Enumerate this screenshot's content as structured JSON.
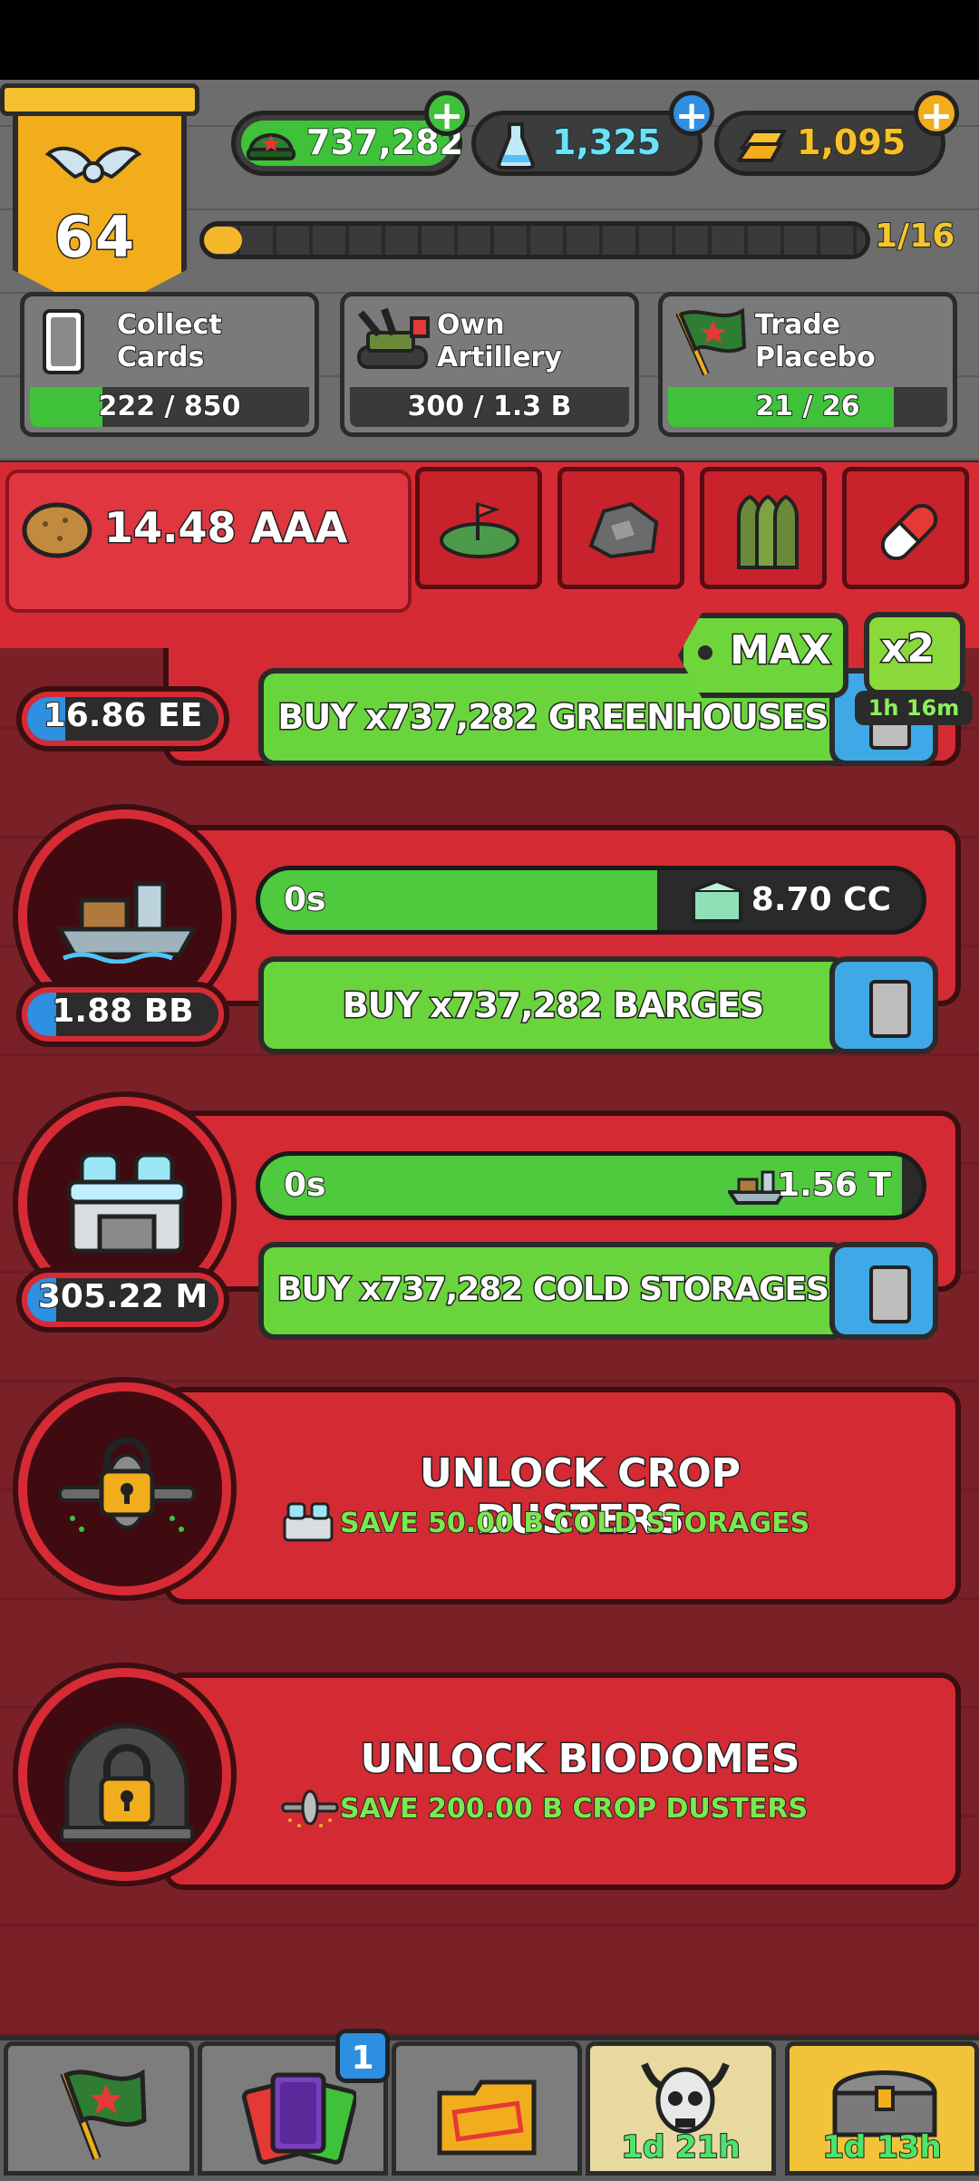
{
  "header": {
    "level": "64",
    "currencies": [
      {
        "name": "cash",
        "value": "737,282",
        "icon": "army-cap-icon"
      },
      {
        "name": "science",
        "value": "1,325",
        "icon": "flask-icon"
      },
      {
        "name": "gold",
        "value": "1,095",
        "icon": "gold-bars-icon"
      }
    ],
    "xp_progress": "1/16",
    "missions": [
      {
        "title": "Collect Cards",
        "progress": "222 / 850",
        "fill": 0.26,
        "icon": "card-icon"
      },
      {
        "title": "Own Artillery",
        "progress": "300 / 1.3 B",
        "fill": 0.0,
        "icon": "artillery-icon"
      },
      {
        "title": "Trade Placebo",
        "progress": "21 / 26",
        "fill": 0.81,
        "icon": "flag-icon"
      }
    ]
  },
  "resource": {
    "amount": "14.48 AAA",
    "icon": "potato-icon",
    "tabs": [
      "farm-tab",
      "ore-tab",
      "ammo-tab",
      "pill-tab"
    ]
  },
  "multiplier": {
    "max_label": "MAX",
    "boost_label": "x2",
    "boost_timer": "1h 16m"
  },
  "units": [
    {
      "count": "16.86 EE",
      "buy_label": "BUY x737,282 GREENHOUSES",
      "icon": "greenhouse-icon",
      "count_fill": 0.2
    },
    {
      "count": "1.88 BB",
      "time": "0s",
      "value": "8.70 CC",
      "buy_label": "BUY x737,282 BARGES",
      "icon": "barge-icon",
      "fill": 0.6,
      "count_fill": 0.15
    },
    {
      "count": "305.22 M",
      "time": "0s",
      "value": "1.56 T",
      "buy_label": "BUY x737,282 COLD STORAGES",
      "icon": "cold-storage-icon",
      "fill": 0.97,
      "count_fill": 0.15
    }
  ],
  "locked": [
    {
      "title": "UNLOCK CROP DUSTERS",
      "requirement": "SAVE 50.00 B COLD STORAGES",
      "icon": "crop-duster-lock-icon"
    },
    {
      "title": "UNLOCK BIODOMES",
      "requirement": "SAVE 200.00 B CROP DUSTERS",
      "icon": "biodome-lock-icon"
    }
  ],
  "nav": {
    "badge": "1",
    "tabs": [
      {
        "name": "missions",
        "icon": "flag-icon"
      },
      {
        "name": "cards",
        "icon": "cards-icon"
      },
      {
        "name": "research",
        "icon": "folder-icon"
      },
      {
        "name": "event",
        "icon": "skull-icon",
        "timer": "1d 21h"
      },
      {
        "name": "chest",
        "icon": "chest-icon",
        "timer": "1d 13h"
      }
    ]
  },
  "colors": {
    "accent_red": "#d62b35",
    "buy_green": "#6ad43d",
    "progress_green": "#4fc93d",
    "gold": "#f2ad1d",
    "blue": "#2f8fe0"
  }
}
